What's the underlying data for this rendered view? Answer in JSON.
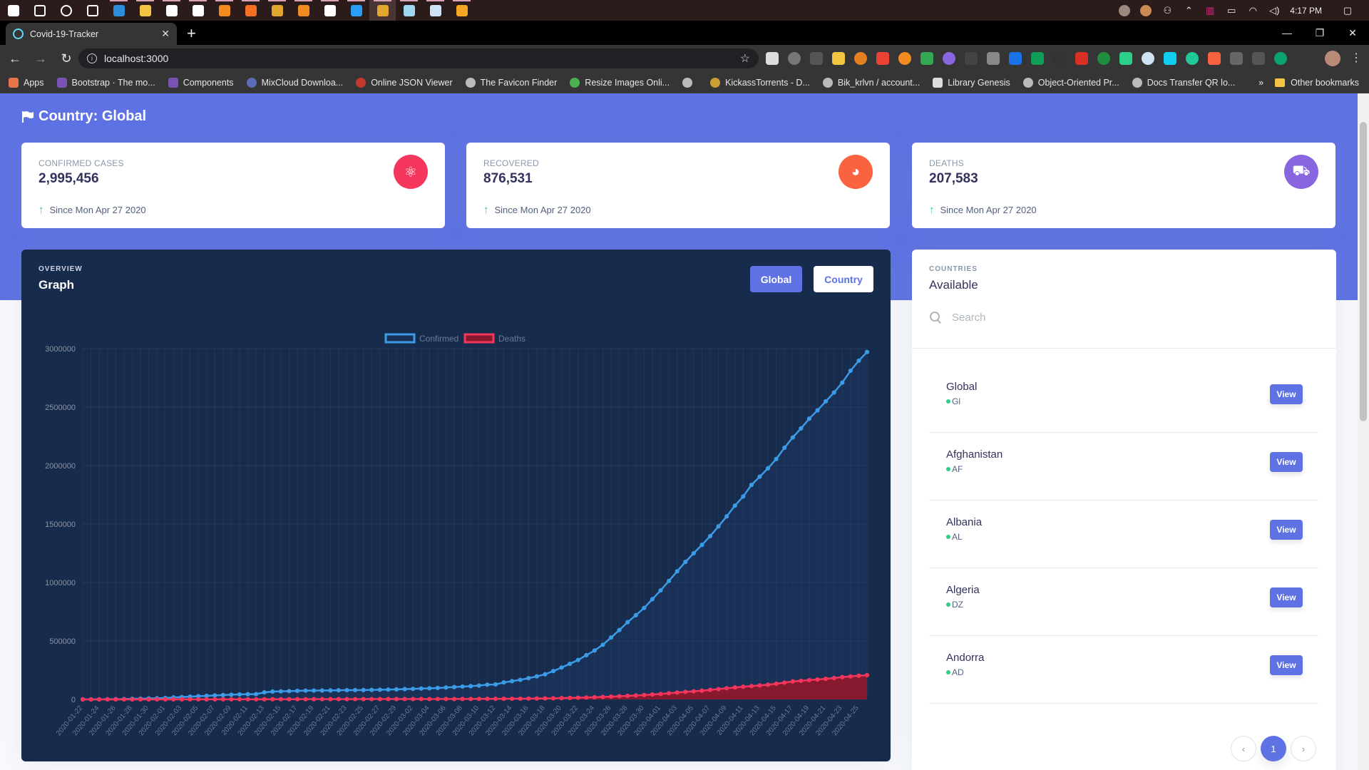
{
  "taskbar": {
    "clock": "4:17 PM",
    "apps": [
      {
        "icon": "windows-start-icon",
        "color": "#ffffff"
      },
      {
        "icon": "search-icon",
        "color": "#ffffff"
      },
      {
        "icon": "cortana-icon",
        "color": "#ffffff"
      },
      {
        "icon": "task-view-icon",
        "color": "#ffffff"
      },
      {
        "icon": "edge-icon",
        "color": "#2e8ddb"
      },
      {
        "icon": "file-explorer-icon",
        "color": "#f4c542"
      },
      {
        "icon": "store-icon",
        "color": "#ffffff"
      },
      {
        "icon": "mail-icon",
        "color": "#ffffff"
      },
      {
        "icon": "sublime-icon",
        "color": "#f28b20"
      },
      {
        "icon": "app-orange-icon",
        "color": "#f36f21"
      },
      {
        "icon": "chrome-icon",
        "color": "#e2a52e"
      },
      {
        "icon": "vlc-icon",
        "color": "#f28b20"
      },
      {
        "icon": "github-desktop-icon",
        "color": "#ffffff"
      },
      {
        "icon": "vscode-icon",
        "color": "#2a9df4"
      },
      {
        "icon": "chrome-active-icon",
        "color": "#e2a52e"
      },
      {
        "icon": "notepad-icon",
        "color": "#9fd6f2"
      },
      {
        "icon": "window-icon",
        "color": "#cde3f5"
      },
      {
        "icon": "postman-icon",
        "color": "#f5a623"
      }
    ]
  },
  "browser": {
    "tab_title": "Covid-19-Tracker",
    "url": "localhost:3000",
    "bookmarks": [
      {
        "label": "Apps",
        "color": "#e8734a"
      },
      {
        "label": "Bootstrap · The mo...",
        "color": "#7952b3"
      },
      {
        "label": "Components",
        "color": "#7952b3"
      },
      {
        "label": "MixCloud Downloa...",
        "color": "#5a6bb8"
      },
      {
        "label": "Online JSON Viewer",
        "color": "#c0392b"
      },
      {
        "label": "The Favicon Finder",
        "color": "#bbbbbb"
      },
      {
        "label": "Resize Images Onli...",
        "color": "#4caf50"
      },
      {
        "label": "",
        "color": "#bbbbbb"
      },
      {
        "label": "KickassTorrents - D...",
        "color": "#c8a032"
      },
      {
        "label": "Bik_krlvn / account...",
        "color": "#bbbbbb"
      },
      {
        "label": "Library Genesis",
        "color": "#dddddd"
      },
      {
        "label": "Object-Oriented Pr...",
        "color": "#bbbbbb"
      },
      {
        "label": "Docs Transfer QR lo...",
        "color": "#bbbbbb"
      }
    ],
    "more_bookmarks": "»",
    "other_bookmarks": "Other bookmarks"
  },
  "page": {
    "title": "Country: Global",
    "stats": [
      {
        "label": "Confirmed Cases",
        "value": "2,995,456",
        "since": "Since Mon Apr 27 2020",
        "icon": "atom-icon",
        "color": "#f5365c"
      },
      {
        "label": "Recovered",
        "value": "876,531",
        "since": "Since Mon Apr 27 2020",
        "icon": "pie-chart-icon",
        "color": "#fb6340"
      },
      {
        "label": "Deaths",
        "value": "207,583",
        "since": "Since Mon Apr 27 2020",
        "icon": "truck-icon",
        "color": "#8965e0"
      }
    ],
    "graph": {
      "overline": "Overview",
      "title": "Graph",
      "buttons": {
        "global": "Global",
        "country": "Country"
      }
    },
    "countries": {
      "overline": "Countries",
      "title": "Available",
      "search_placeholder": "Search",
      "view_label": "View",
      "list": [
        {
          "name": "Global",
          "code": "Gl"
        },
        {
          "name": "Afghanistan",
          "code": "AF"
        },
        {
          "name": "Albania",
          "code": "AL"
        },
        {
          "name": "Algeria",
          "code": "DZ"
        },
        {
          "name": "Andorra",
          "code": "AD"
        }
      ],
      "pagination": {
        "prev": "‹",
        "current": "1",
        "next": "›"
      }
    }
  },
  "chart_data": {
    "type": "line",
    "title": "",
    "xlabel": "",
    "ylabel": "",
    "ylim": [
      0,
      3000000
    ],
    "yticks": [
      0,
      500000,
      1000000,
      1500000,
      2000000,
      2500000,
      3000000
    ],
    "legend": "top-center",
    "grid": true,
    "x": [
      "2020-01-22",
      "2020-01-23",
      "2020-01-24",
      "2020-01-25",
      "2020-01-26",
      "2020-01-27",
      "2020-01-28",
      "2020-01-29",
      "2020-01-30",
      "2020-01-31",
      "2020-02-01",
      "2020-02-02",
      "2020-02-03",
      "2020-02-04",
      "2020-02-05",
      "2020-02-06",
      "2020-02-07",
      "2020-02-08",
      "2020-02-09",
      "2020-02-10",
      "2020-02-11",
      "2020-02-12",
      "2020-02-13",
      "2020-02-14",
      "2020-02-15",
      "2020-02-16",
      "2020-02-17",
      "2020-02-18",
      "2020-02-19",
      "2020-02-20",
      "2020-02-21",
      "2020-02-22",
      "2020-02-23",
      "2020-02-24",
      "2020-02-25",
      "2020-02-26",
      "2020-02-27",
      "2020-02-28",
      "2020-02-29",
      "2020-03-01",
      "2020-03-02",
      "2020-03-03",
      "2020-03-04",
      "2020-03-05",
      "2020-03-06",
      "2020-03-07",
      "2020-03-08",
      "2020-03-09",
      "2020-03-10",
      "2020-03-11",
      "2020-03-12",
      "2020-03-13",
      "2020-03-14",
      "2020-03-15",
      "2020-03-16",
      "2020-03-17",
      "2020-03-18",
      "2020-03-19",
      "2020-03-20",
      "2020-03-21",
      "2020-03-22",
      "2020-03-23",
      "2020-03-24",
      "2020-03-25",
      "2020-03-26",
      "2020-03-27",
      "2020-03-28",
      "2020-03-29",
      "2020-03-30",
      "2020-03-31",
      "2020-04-01",
      "2020-04-02",
      "2020-04-03",
      "2020-04-04",
      "2020-04-05",
      "2020-04-06",
      "2020-04-07",
      "2020-04-08",
      "2020-04-09",
      "2020-04-10",
      "2020-04-11",
      "2020-04-12",
      "2020-04-13",
      "2020-04-14",
      "2020-04-15",
      "2020-04-16",
      "2020-04-17",
      "2020-04-18",
      "2020-04-19",
      "2020-04-20",
      "2020-04-21",
      "2020-04-22",
      "2020-04-23",
      "2020-04-24",
      "2020-04-25",
      "2020-04-26"
    ],
    "series": [
      {
        "name": "Confirmed",
        "color": "#3b9be6",
        "values": [
          555,
          654,
          941,
          1434,
          2118,
          2927,
          5578,
          6166,
          8234,
          9927,
          12038,
          16787,
          19881,
          23892,
          27635,
          30794,
          34391,
          37120,
          40150,
          42762,
          44802,
          45221,
          60368,
          66885,
          69030,
          71224,
          73258,
          75136,
          75639,
          76197,
          76819,
          78572,
          78958,
          79561,
          80406,
          81388,
          82746,
          84112,
          86011,
          88369,
          90306,
          92840,
          95120,
          97886,
          101801,
          105847,
          109821,
          113590,
          118620,
          125875,
          128352,
          145205,
          156101,
          167454,
          181574,
          197102,
          214821,
          242570,
          272208,
          304507,
          336953,
          378235,
          418045,
          467653,
          529591,
          593291,
          660706,
          720117,
          782365,
          857487,
          932605,
          1013466,
          1095917,
          1176060,
          1249754,
          1321481,
          1396476,
          1479804,
          1565278,
          1657526,
          1735650,
          1834721,
          1904838,
          1976191,
          2056054,
          2152437,
          2240191,
          2317759,
          2401379,
          2472259,
          2549123,
          2624610,
          2708885,
          2811193,
          2896746,
          2971475
        ]
      },
      {
        "name": "Deaths",
        "color": "#f5365c",
        "values": [
          17,
          18,
          26,
          42,
          56,
          82,
          131,
          133,
          171,
          213,
          259,
          362,
          426,
          492,
          564,
          634,
          719,
          806,
          906,
          1013,
          1113,
          1118,
          1371,
          1523,
          1666,
          1770,
          1868,
          2007,
          2122,
          2247,
          2251,
          2458,
          2469,
          2629,
          2708,
          2770,
          2814,
          2872,
          2941,
          2996,
          3085,
          3160,
          3254,
          3348,
          3460,
          3558,
          3802,
          3988,
          4262,
          4615,
          4720,
          5404,
          5819,
          6440,
          7126,
          7905,
          8733,
          9867,
          11299,
          12973,
          14623,
          16497,
          18615,
          21181,
          23970,
          27198,
          30652,
          33925,
          37582,
          42107,
          46809,
          52983,
          58787,
          64606,
          69374,
          74565,
          81865,
          88338,
          95455,
          102525,
          108502,
          114091,
          119482,
          125984,
          134176,
          143800,
          153822,
          159510,
          165044,
          169986,
          176583,
          183066,
          190858,
          197159,
          202846,
          207583
        ]
      }
    ]
  }
}
